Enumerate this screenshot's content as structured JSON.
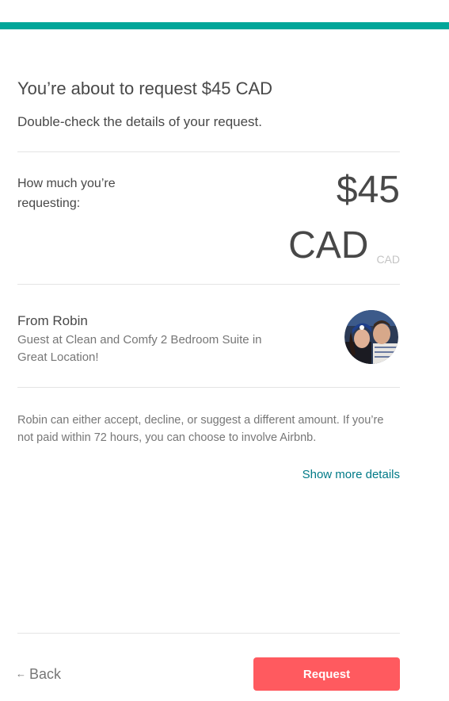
{
  "header": {
    "title": "You’re about to request $45 CAD",
    "subtitle": "Double-check the details of your request."
  },
  "amount": {
    "label": "How much you’re requesting:",
    "value": "$45",
    "currency": "CAD",
    "currency_small": "CAD"
  },
  "guest": {
    "name": "From Robin",
    "description": "Guest at Clean and Comfy 2 Bedroom Suite in Great Location!",
    "avatar_icon": "user-photo"
  },
  "note": "Robin can either accept, decline, or suggest a different amount. If you’re not paid within 72 hours, you can choose to involve Airbnb.",
  "links": {
    "show_more": "Show more details"
  },
  "footer": {
    "back_label": "Back",
    "back_icon": "arrow-left-icon",
    "request_label": "Request"
  },
  "colors": {
    "accent_bar": "#00a699",
    "link": "#007a87",
    "primary_button": "#ff5a5f"
  }
}
